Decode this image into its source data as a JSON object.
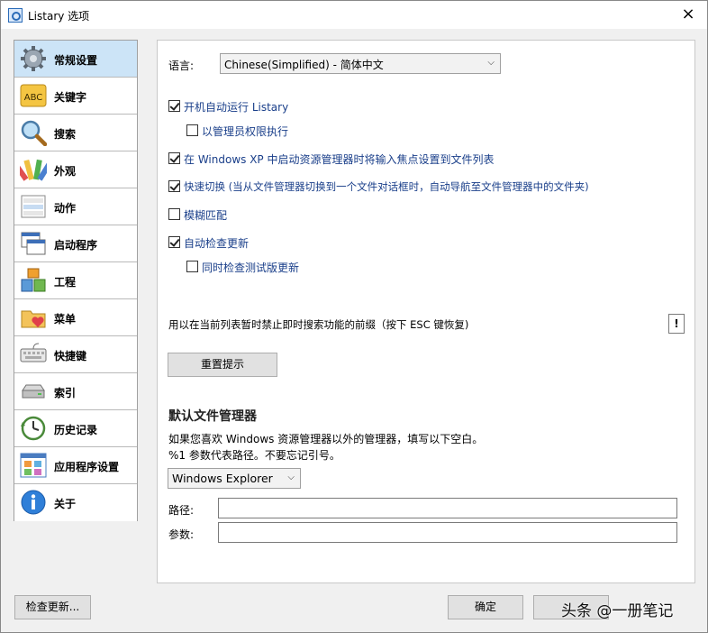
{
  "window": {
    "title": "Listary 选项",
    "close_glyph": "×"
  },
  "sidebar": {
    "items": [
      {
        "label": "常规设置",
        "icon": "gear-icon",
        "active": true
      },
      {
        "label": "关键字",
        "icon": "abc-icon"
      },
      {
        "label": "搜索",
        "icon": "magnifier-icon"
      },
      {
        "label": "外观",
        "icon": "palette-icon"
      },
      {
        "label": "动作",
        "icon": "menu-list-icon"
      },
      {
        "label": "启动程序",
        "icon": "windows-icon"
      },
      {
        "label": "工程",
        "icon": "boxes-icon"
      },
      {
        "label": "菜单",
        "icon": "folder-heart-icon"
      },
      {
        "label": "快捷键",
        "icon": "keyboard-icon"
      },
      {
        "label": "索引",
        "icon": "drive-icon"
      },
      {
        "label": "历史记录",
        "icon": "clock-icon"
      },
      {
        "label": "应用程序设置",
        "icon": "app-grid-icon"
      },
      {
        "label": "关于",
        "icon": "info-icon"
      }
    ]
  },
  "general": {
    "language_label": "语言:",
    "language_value": "Chinese(Simplified) - 简体中文",
    "options": [
      {
        "label": "开机自动运行 Listary",
        "checked": true
      },
      {
        "label": "以管理员权限执行",
        "checked": false
      },
      {
        "label": "在 Windows XP 中启动资源管理器时将输入焦点设置到文件列表",
        "checked": true
      },
      {
        "label": "快速切换 (当从文件管理器切换到一个文件对话框时，自动导航至文件管理器中的文件夹)",
        "checked": true
      },
      {
        "label": "模糊匹配",
        "checked": false
      },
      {
        "label": "自动检查更新",
        "checked": true
      },
      {
        "label": "同时检查测试版更新",
        "checked": false
      }
    ],
    "prefix_label": "用以在当前列表暂时禁止即时搜索功能的前缀（按下 ESC 键恢复)",
    "prefix_value": "!",
    "reset_hints_button": "重置提示",
    "fm_heading": "默认文件管理器",
    "fm_desc_line1": "如果您喜欢 Windows 资源管理器以外的管理器，填写以下空白。",
    "fm_desc_line2": "%1 参数代表路径。不要忘记引号。",
    "fm_select_value": "Windows Explorer",
    "path_label": "路径:",
    "path_value": "",
    "params_label": "参数:",
    "params_value": ""
  },
  "footer": {
    "check_updates_button": "检查更新...",
    "ok_button": "确定",
    "cancel_button": "取消",
    "watermark": "头条 @一册笔记"
  }
}
